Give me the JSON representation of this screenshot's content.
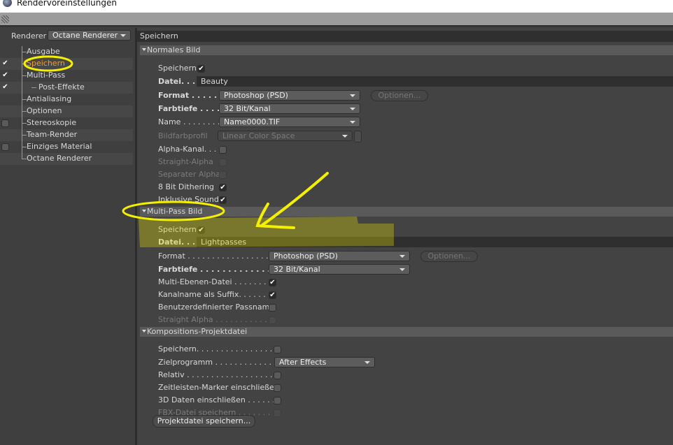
{
  "window": {
    "title": "Rendervoreinstellungen"
  },
  "sidebar": {
    "renderer_label": "Renderer",
    "renderer_value": "Octane Renderer",
    "items": [
      {
        "label": "Ausgabe",
        "check": "none"
      },
      {
        "label": "Speichern",
        "check": "on",
        "selected": true
      },
      {
        "label": "Multi-Pass",
        "check": "on",
        "expanded": true
      },
      {
        "label": "Post-Effekte",
        "check": "on",
        "sub": true
      },
      {
        "label": "Antialiasing",
        "check": "none"
      },
      {
        "label": "Optionen",
        "check": "none"
      },
      {
        "label": "Stereoskopie",
        "check": "off"
      },
      {
        "label": "Team-Render",
        "check": "none"
      },
      {
        "label": "Einziges Material",
        "check": "off"
      },
      {
        "label": "Octane Renderer",
        "check": "none"
      }
    ]
  },
  "panel": {
    "title": "Speichern",
    "sections": [
      {
        "title": "Normales Bild",
        "rows": [
          {
            "label": "Speichern",
            "type": "check",
            "checked": true,
            "inline": true
          },
          {
            "label": "Datei. . . .",
            "bold": true,
            "type": "text",
            "value": "Beauty"
          },
          {
            "label": "Format . . . . . . .",
            "bold": true,
            "type": "dropdown",
            "value": "Photoshop (PSD)",
            "button": "Optionen..."
          },
          {
            "label": "Farbtiefe . . . . .",
            "bold": true,
            "type": "dropdown",
            "value": "32 Bit/Kanal"
          },
          {
            "label": "Name . . . . . . . .",
            "type": "dropdown",
            "value": "Name0000.TIF"
          },
          {
            "label": "Bildfarbprofil",
            "dim": true,
            "type": "profile",
            "value": "Linear Color Space"
          },
          {
            "label": "Alpha-Kanal. . .",
            "type": "check",
            "checked": false
          },
          {
            "label": "Straight-Alpha",
            "dim": true,
            "type": "check",
            "checked": false
          },
          {
            "label": "Separater Alpha",
            "dim": true,
            "type": "check",
            "checked": false
          },
          {
            "label": "8 Bit Dithering",
            "type": "check",
            "checked": true
          },
          {
            "label": "Inklusive Sound",
            "type": "check",
            "checked": true
          }
        ]
      },
      {
        "title": "Multi-Pass Bild",
        "rows": [
          {
            "label": "Speichern",
            "type": "check",
            "checked": true,
            "inline": true
          },
          {
            "label": "Datei. . . .",
            "bold": true,
            "type": "text",
            "value": "Lightpasses"
          },
          {
            "label": "Format . . . . . . . . . . . . . . . . . .",
            "type": "dropdown",
            "value": "Photoshop (PSD)",
            "button": "Optionen..."
          },
          {
            "label": "Farbtiefe . . . . . . . . . . . . . . .",
            "bold": true,
            "type": "dropdown",
            "value": "32 Bit/Kanal"
          },
          {
            "label": "Multi-Ebenen-Datei . . . . . . . .",
            "type": "check",
            "checked": true
          },
          {
            "label": "Kanalname als Suffix. . . . . . . .",
            "type": "check",
            "checked": true
          },
          {
            "label": "Benutzerdefinierter Passname",
            "type": "check",
            "checked": false
          },
          {
            "label": "Straight Alpha . . . . . . . . . . . .",
            "dim": true,
            "type": "check",
            "checked": false
          }
        ]
      },
      {
        "title": "Kompositions-Projektdatei",
        "rows": [
          {
            "label": "Speichern. . . . . . . . . . . . . . . . .",
            "type": "check",
            "checked": false
          },
          {
            "label": "Zielprogramm . . . . . . . . . . . . .",
            "type": "dropdown",
            "value": "After Effects"
          },
          {
            "label": "Relativ . . . . . . . . . . . . . . . . . .",
            "type": "check",
            "checked": false
          },
          {
            "label": "Zeitleisten-Marker einschließen",
            "type": "check",
            "checked": false
          },
          {
            "label": "3D Daten einschließen . . . . . . .",
            "type": "check",
            "checked": false
          },
          {
            "label": "FBX-Datei speichern . . . . . . . . .",
            "dim": true,
            "type": "check",
            "checked": false
          }
        ],
        "button": "Projektdatei speichern..."
      }
    ]
  },
  "annotation_color": "#f5f000"
}
